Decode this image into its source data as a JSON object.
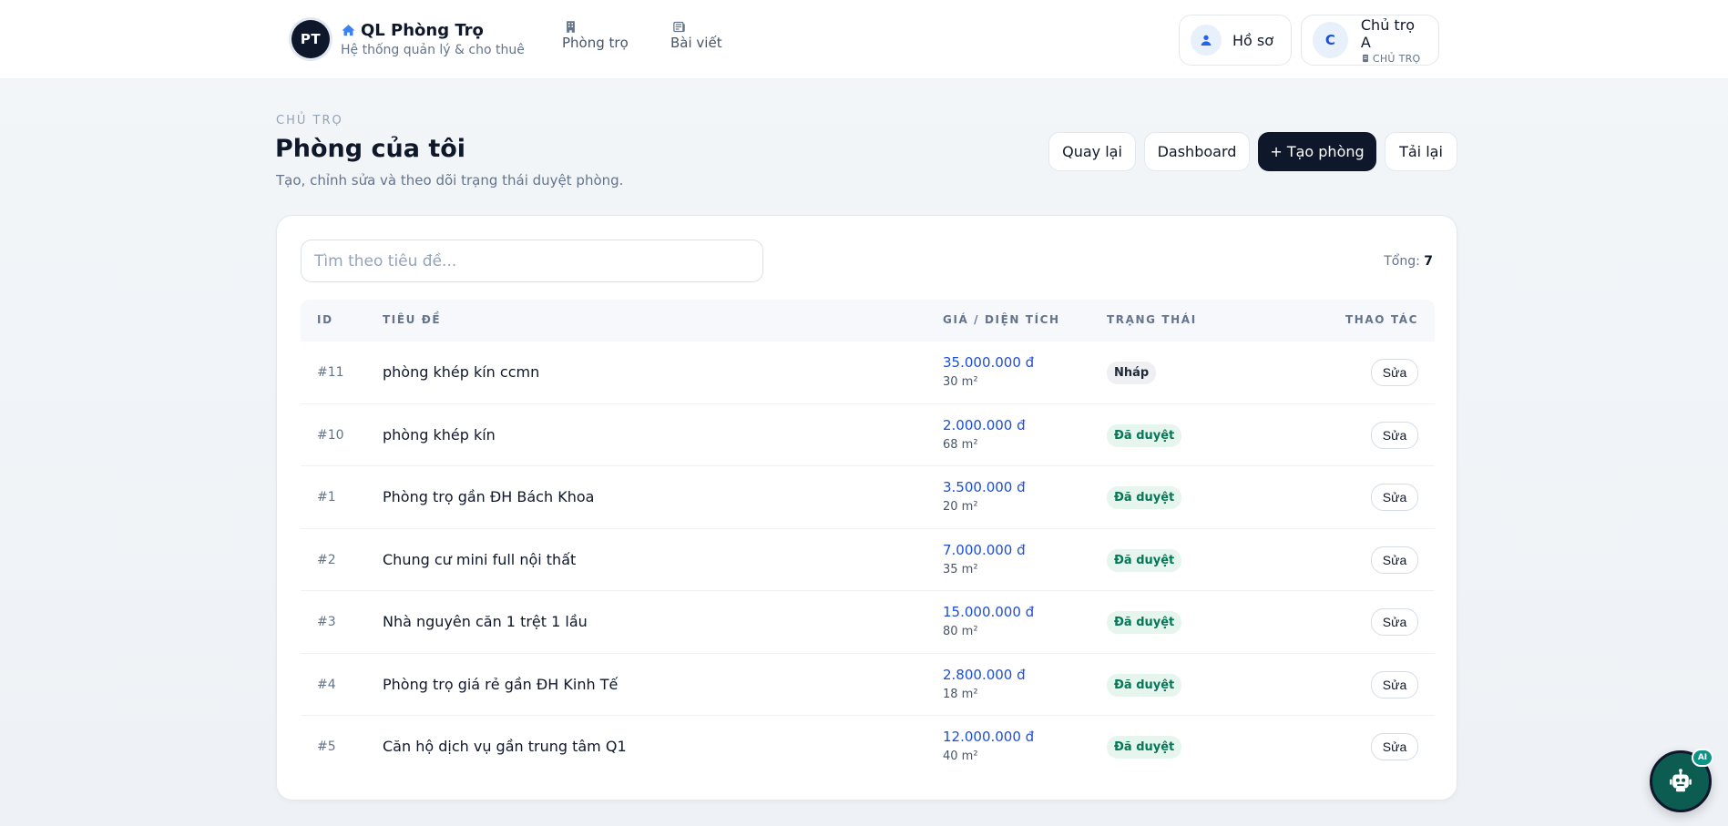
{
  "brand": {
    "logo_text": "PT",
    "title": "QL Phòng Trọ",
    "subtitle": "Hệ thống quản lý & cho thuê",
    "icon": "home-icon"
  },
  "nav": {
    "rooms_label": "Phòng trọ",
    "rooms_icon": "building-icon",
    "posts_label": "Bài viết",
    "posts_icon": "newspaper-icon"
  },
  "profile": {
    "label": "Hồ sơ",
    "icon": "user-icon"
  },
  "user": {
    "initial": "C",
    "name": "Chủ trọ A",
    "role": "CHỦ TRỌ",
    "role_icon": "id-card-icon"
  },
  "page": {
    "eyebrow": "CHỦ TRỌ",
    "title": "Phòng của tôi",
    "description": "Tạo, chỉnh sửa và theo dõi trạng thái duyệt phòng."
  },
  "actions": {
    "back": "Quay lại",
    "dashboard": "Dashboard",
    "create": "+ Tạo phòng",
    "reload": "Tải lại"
  },
  "search": {
    "placeholder": "Tìm theo tiêu đề..."
  },
  "total": {
    "label": "Tổng:",
    "value": "7"
  },
  "table": {
    "headers": {
      "id": "ID",
      "title": "TIÊU ĐỀ",
      "price_area": "GIÁ / DIỆN TÍCH",
      "status": "TRẠNG THÁI",
      "actions": "THAO TÁC"
    },
    "rows": [
      {
        "id": "#11",
        "title": "phòng khép kín ccmn",
        "price": "35.000.000 đ",
        "area": "30 m²",
        "status": "Nháp",
        "status_type": "draft",
        "action": "Sửa"
      },
      {
        "id": "#10",
        "title": "phòng khép kín",
        "price": "2.000.000 đ",
        "area": "68 m²",
        "status": "Đã duyệt",
        "status_type": "approved",
        "action": "Sửa"
      },
      {
        "id": "#1",
        "title": "Phòng trọ gần ĐH Bách Khoa",
        "price": "3.500.000 đ",
        "area": "20 m²",
        "status": "Đã duyệt",
        "status_type": "approved",
        "action": "Sửa"
      },
      {
        "id": "#2",
        "title": "Chung cư mini full nội thất",
        "price": "7.000.000 đ",
        "area": "35 m²",
        "status": "Đã duyệt",
        "status_type": "approved",
        "action": "Sửa"
      },
      {
        "id": "#3",
        "title": "Nhà nguyên căn 1 trệt 1 lầu",
        "price": "15.000.000 đ",
        "area": "80 m²",
        "status": "Đã duyệt",
        "status_type": "approved",
        "action": "Sửa"
      },
      {
        "id": "#4",
        "title": "Phòng trọ giá rẻ gần ĐH Kinh Tế",
        "price": "2.800.000 đ",
        "area": "18 m²",
        "status": "Đã duyệt",
        "status_type": "approved",
        "action": "Sửa"
      },
      {
        "id": "#5",
        "title": "Căn hộ dịch vụ gần trung tâm Q1",
        "price": "12.000.000 đ",
        "area": "40 m²",
        "status": "Đã duyệt",
        "status_type": "approved",
        "action": "Sửa"
      }
    ]
  },
  "assistant": {
    "badge": "AI",
    "icon": "robot-icon"
  },
  "colors": {
    "primary_dark": "#0f172a",
    "price_blue": "#1d4ed8",
    "approved_green": "#047857",
    "bot_teal": "#0d5c52"
  }
}
